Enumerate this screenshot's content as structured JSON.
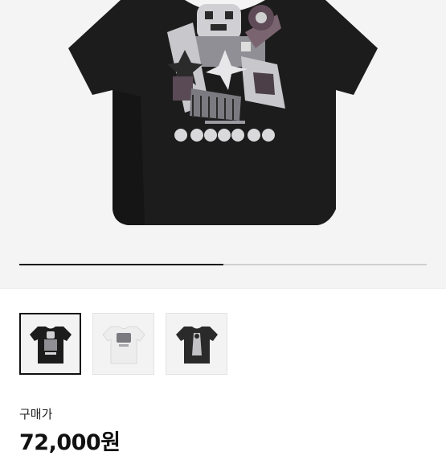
{
  "product": {
    "images": [
      {
        "icon": "black-tshirt-graphic-icon",
        "selected": true
      },
      {
        "icon": "white-tshirt-graphic-icon",
        "selected": false
      },
      {
        "icon": "black-tshirt-print-icon",
        "selected": false
      }
    ],
    "gallery_progress_fraction": 0.5
  },
  "price": {
    "label": "구매가",
    "value": "72,000원"
  },
  "colors": {
    "shirt_black": "#1c1c1c",
    "shirt_white": "#ededed",
    "selected_border": "#111111"
  }
}
